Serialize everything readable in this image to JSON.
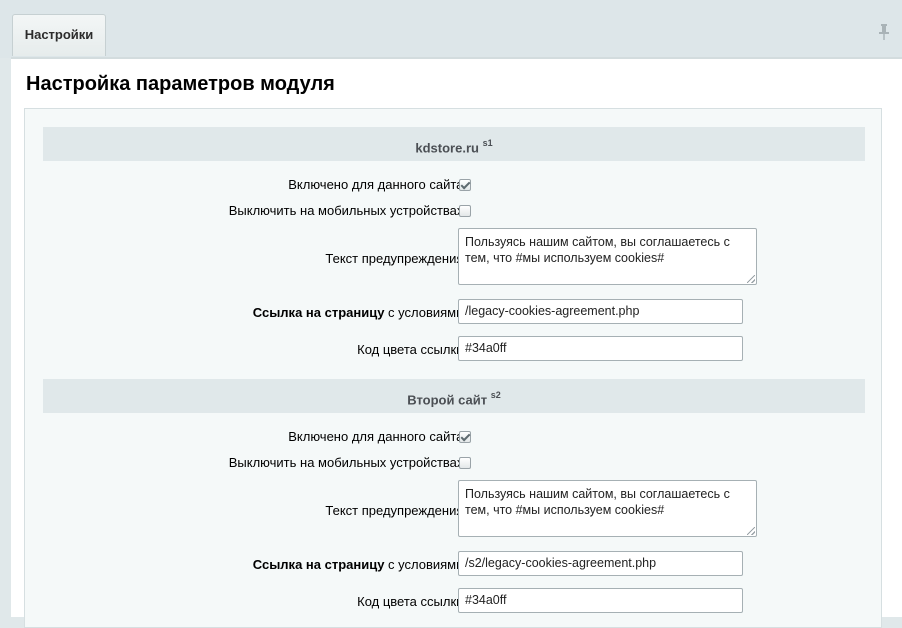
{
  "tabs": [
    {
      "label": "Настройки"
    }
  ],
  "page_title": "Настройка параметров модуля",
  "sites": [
    {
      "name": "kdstore.ru",
      "id": "s1",
      "enabled_label": "Включено для данного сайта:",
      "enabled": true,
      "mobile_label": "Выключить на мобильных устройствах:",
      "mobile_disabled": false,
      "warning_label": "Текст предупреждения:",
      "warning_text": "Пользуясь нашим сайтом, вы соглашаетесь с тем, что #мы используем cookies#",
      "link_label_bold": "Ссылка на страницу",
      "link_label_rest": " с условиями:",
      "link_value": "/legacy-cookies-agreement.php",
      "color_label": "Код цвета ссылки:",
      "color_value": "#34a0ff"
    },
    {
      "name": "Второй сайт",
      "id": "s2",
      "enabled_label": "Включено для данного сайта:",
      "enabled": true,
      "mobile_label": "Выключить на мобильных устройствах:",
      "mobile_disabled": false,
      "warning_label": "Текст предупреждения:",
      "warning_text": "Пользуясь нашим сайтом, вы соглашаетесь с тем, что #мы используем cookies#",
      "link_label_bold": "Ссылка на страницу",
      "link_label_rest": " с условиями:",
      "link_value": "/s2/legacy-cookies-agreement.php",
      "color_label": "Код цвета ссылки:",
      "color_value": "#34a0ff"
    }
  ],
  "icons": {
    "pin": "pin-icon"
  },
  "colors": {
    "accent_link": "#34a0ff",
    "header_bg": "#e0e8ea"
  }
}
